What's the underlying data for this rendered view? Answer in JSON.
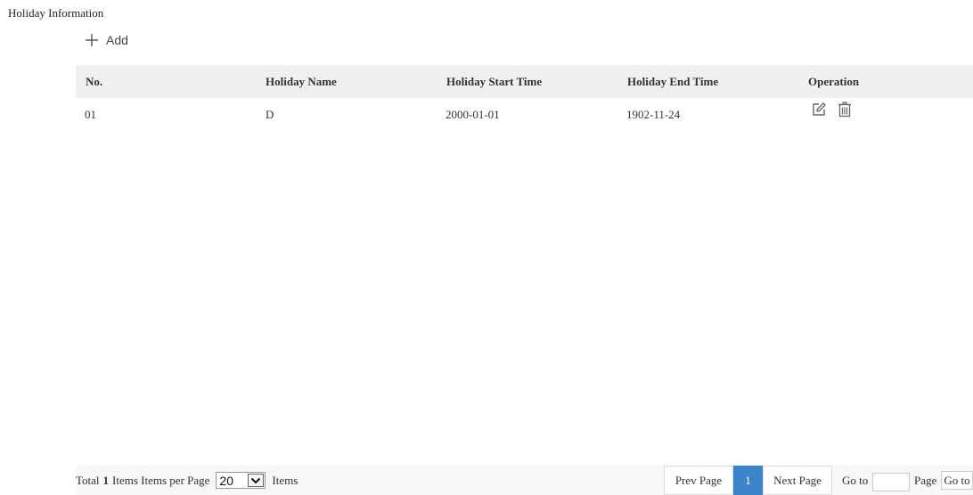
{
  "page": {
    "title": "Holiday Information",
    "add_label": "Add"
  },
  "table": {
    "columns": [
      "No.",
      "Holiday Name",
      "Holiday Start Time",
      "Holiday End Time",
      "Operation"
    ],
    "rows": [
      {
        "no": "01",
        "name": "D",
        "start": "2000-01-01",
        "end": "1902-11-24"
      }
    ]
  },
  "footer": {
    "total_prefix": "Total",
    "total_count": "1",
    "items_per_page_label": "Items Items per Page",
    "page_size": "20",
    "items_suffix": "Items",
    "prev_label": "Prev Page",
    "current_page": "1",
    "next_label": "Next Page",
    "goto_label": "Go to",
    "page_label": "Page",
    "goto_button": "Go to"
  },
  "colors": {
    "header_bg": "#f0f0f0",
    "active_page": "#3a86c8",
    "footer_bg": "#f7f7f7"
  },
  "icons": [
    "plus-icon",
    "edit-icon",
    "delete-icon",
    "chevron-down-icon"
  ]
}
